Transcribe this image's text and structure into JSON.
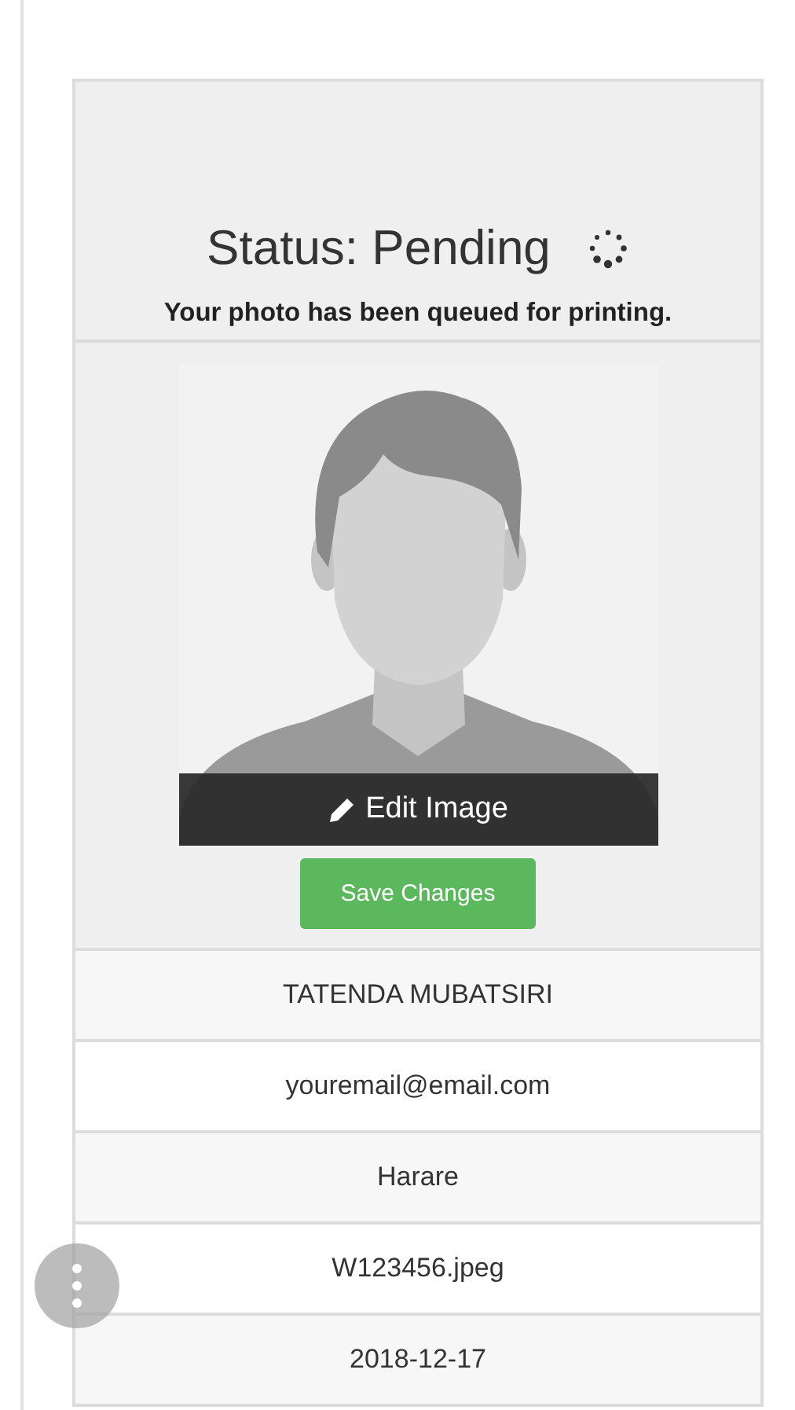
{
  "status": {
    "title": "Status: Pending",
    "message": "Your photo has been queued for printing."
  },
  "photo": {
    "edit_label": "Edit Image",
    "save_label": "Save Changes"
  },
  "details": [
    {
      "value": "TATENDA MUBATSIRI"
    },
    {
      "value": "youremail@email.com"
    },
    {
      "value": "Harare"
    },
    {
      "value": "W123456.jpeg"
    },
    {
      "value": "2018-12-17"
    }
  ]
}
